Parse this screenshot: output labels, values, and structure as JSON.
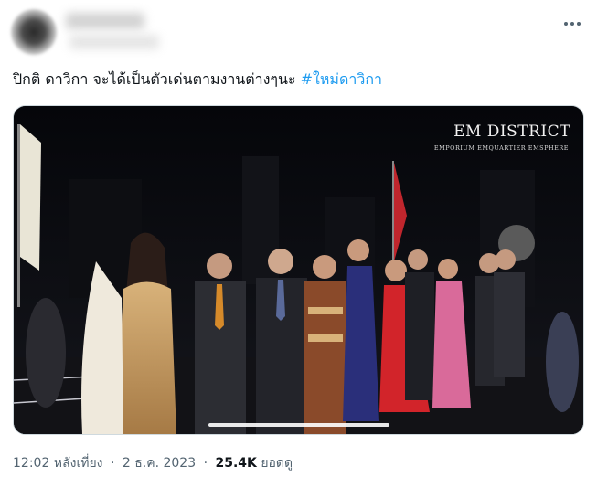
{
  "tweet": {
    "text": "ปิกติ ดาวิกา จะได้เป็นตัวเด่นตามงานต่างๆนะ",
    "hashtag": "#ใหม่ดาวิกา"
  },
  "media": {
    "watermark_title": "EM DISTRICT",
    "watermark_subtitle": "EMPORIUM  EMQUARTIER  EMSPHERE",
    "video_progress_fraction": 0.32
  },
  "meta": {
    "time": "12:02 หลังเที่ยง",
    "date": "2 ธ.ค. 2023",
    "views_count": "25.4K",
    "views_label": "ยอดดู",
    "separator": "·"
  },
  "icons": {
    "more": "more-horizontal-icon"
  },
  "colors": {
    "hashtag": "#1d9bf0",
    "secondary_text": "#536471",
    "primary_text": "#0f1419"
  }
}
